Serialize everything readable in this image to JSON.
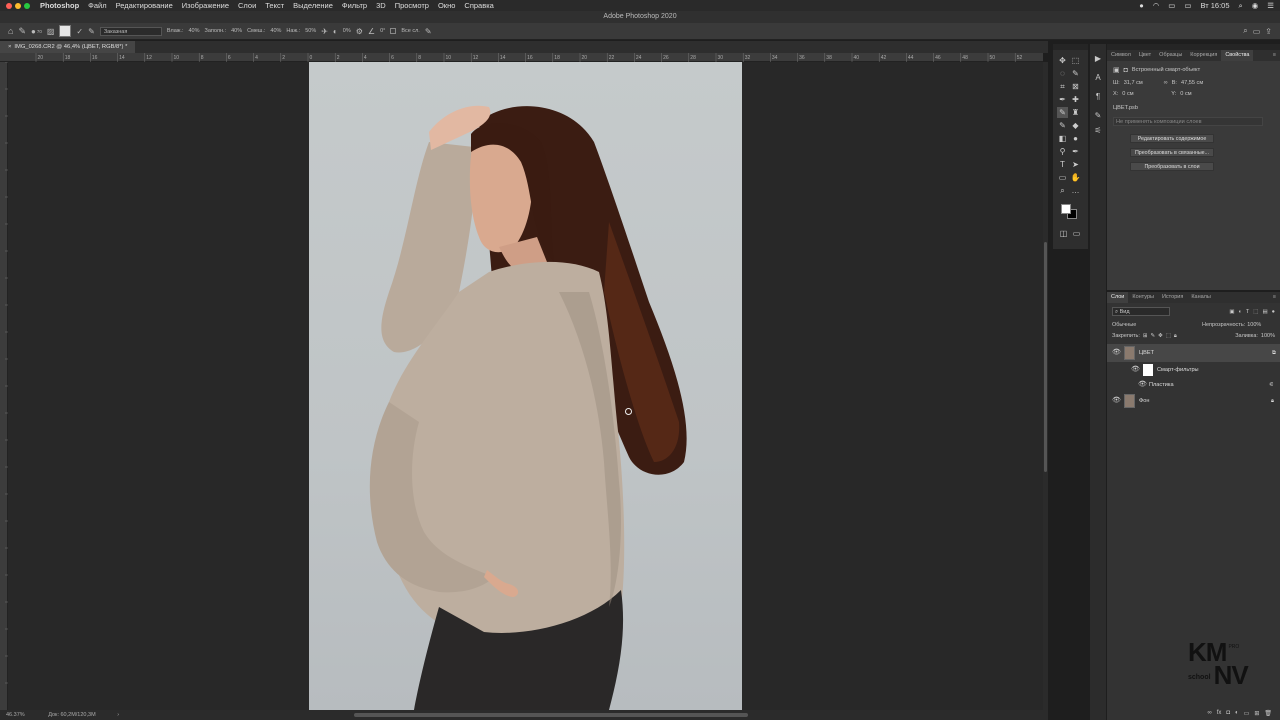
{
  "menubar": {
    "app": "Photoshop",
    "items": [
      "Файл",
      "Редактирование",
      "Изображение",
      "Слои",
      "Текст",
      "Выделение",
      "Фильтр",
      "3D",
      "Просмотр",
      "Окно",
      "Справка"
    ],
    "clock": "Вт 16:05"
  },
  "window_title": "Adobe Photoshop 2020",
  "options_bar": {
    "brush_size": "70",
    "mode": "Заказная",
    "flow_label": "Влаж.:",
    "flow_value": "40%",
    "fill_label": "Заполн.:",
    "fill_value": "40%",
    "mix_label": "Смеш.:",
    "mix_value": "40%",
    "pressure_label": "Наж.:",
    "pressure_value": "50%",
    "angle_value": "0%",
    "angle2": "0°",
    "all_layers": "Все сл."
  },
  "document": {
    "tab_title": "IMG_0268.CR2 @ 46,4% (ЦВЕТ, RGB/8*) *",
    "zoom": "46.37%",
    "doc_info": "Док: 60,2M/120,3M"
  },
  "ruler_top_labels": [
    "20",
    "18",
    "16",
    "14",
    "12",
    "10",
    "8",
    "6",
    "4",
    "2",
    "0",
    "2",
    "4",
    "6",
    "8",
    "10",
    "12",
    "14",
    "16",
    "18",
    "20",
    "22",
    "24",
    "26",
    "28",
    "30",
    "32",
    "34",
    "36",
    "38",
    "40",
    "42",
    "44",
    "46",
    "48",
    "50",
    "52"
  ],
  "properties_panel": {
    "tabs": [
      "Символ",
      "Цвет",
      "Образцы",
      "Коррекция",
      "Свойства"
    ],
    "active_tab": "Свойства",
    "object_type": "Встроенный смарт-объект",
    "w_label": "Ш:",
    "w_value": "31,7 см",
    "h_label": "В:",
    "h_value": "47,55 см",
    "x_label": "X:",
    "x_value": "0 см",
    "y_label": "Y:",
    "y_value": "0 см",
    "file": "ЦВЕТ.psb",
    "comps_placeholder": "Не применять композиции слоев",
    "buttons": [
      "Редактировать содержимое",
      "Преобразовать в связанные...",
      "Преобразовать в слои"
    ]
  },
  "layers_panel": {
    "tabs": [
      "Слои",
      "Контуры",
      "История",
      "Каналы"
    ],
    "active_tab": "Слои",
    "filter": "Вид",
    "blend_mode": "Обычные",
    "opacity_label": "Непрозрачность:",
    "opacity": "100%",
    "lock_label": "Закрепить:",
    "fill_label": "Заливка:",
    "fill": "100%",
    "layers": [
      {
        "name": "ЦВЕТ"
      },
      {
        "name": "Смарт-фильтры"
      },
      {
        "name": "Пластика"
      },
      {
        "name": "Фон"
      }
    ]
  },
  "watermark": {
    "line1": "KM",
    "line2": "school",
    "line3": "NV",
    "sub": "PRO"
  }
}
